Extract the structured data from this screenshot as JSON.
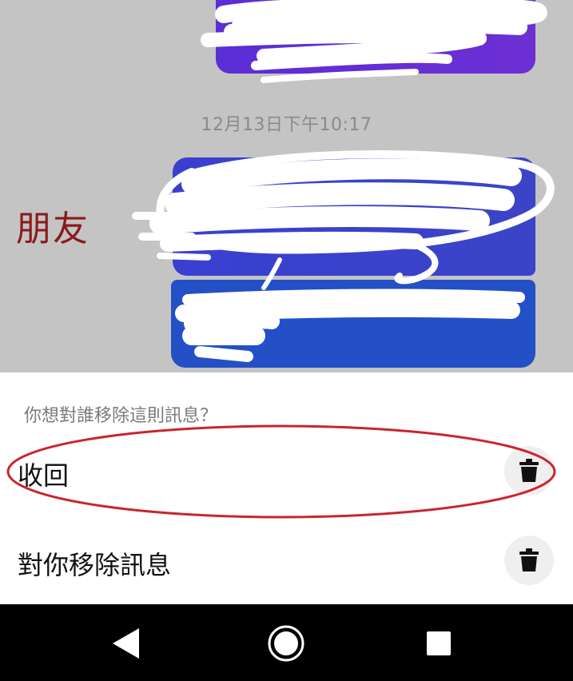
{
  "chat": {
    "timestamp": "12月13日下午10:17",
    "annotation": "朋友",
    "bubble_colors": [
      "#5a2ed6",
      "#3a3fd0",
      "#2350c6"
    ],
    "background_color": "#c4c4c4"
  },
  "sheet": {
    "question": "你想對誰移除這則訊息？",
    "options": [
      {
        "label": "收回",
        "icon": "trash-icon"
      },
      {
        "label": "對你移除訊息",
        "icon": "trash-icon"
      }
    ],
    "highlight_color": "#c8262d"
  },
  "nav": {
    "back_icon": "back-triangle-icon",
    "home_icon": "home-circle-icon",
    "recents_icon": "recents-square-icon"
  }
}
